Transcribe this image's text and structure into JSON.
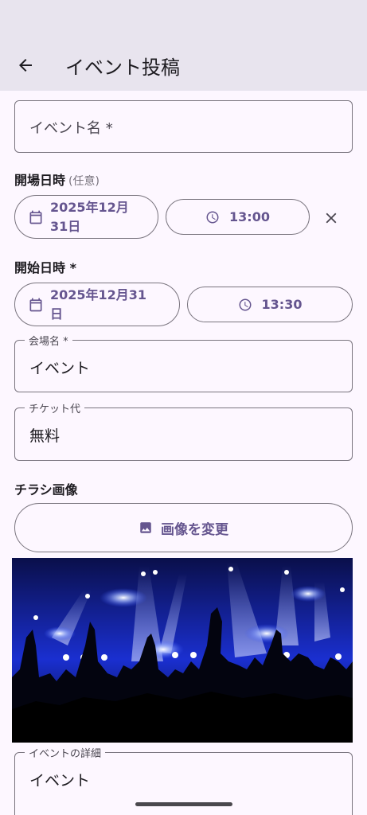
{
  "app_bar": {
    "title": "イベント投稿"
  },
  "event_name": {
    "placeholder": "イベント名 *"
  },
  "open_datetime": {
    "label": "開場日時",
    "optional_label": "(任意)",
    "date_line1": "2025年12月",
    "date_line2": "31日",
    "time": "13:00"
  },
  "start_datetime": {
    "label": "開始日時 *",
    "date_line1": "2025年12月31",
    "date_line2": "日",
    "time": "13:30"
  },
  "venue": {
    "label": "会場名 *",
    "value": "イベント"
  },
  "ticket": {
    "label": "チケット代",
    "value": "無料"
  },
  "flyer": {
    "label": "チラシ画像",
    "change_button": "画像を変更"
  },
  "details": {
    "label": "イベントの詳細",
    "value": "イベント"
  },
  "colors": {
    "accent": "#65558f",
    "app_bar_bg": "#e8e4ee",
    "background": "#fdf7ff",
    "outline": "#79747e"
  },
  "icons": {
    "back": "arrow-left-icon",
    "calendar": "calendar-icon",
    "clock": "clock-icon",
    "close": "close-icon",
    "image": "image-icon"
  }
}
